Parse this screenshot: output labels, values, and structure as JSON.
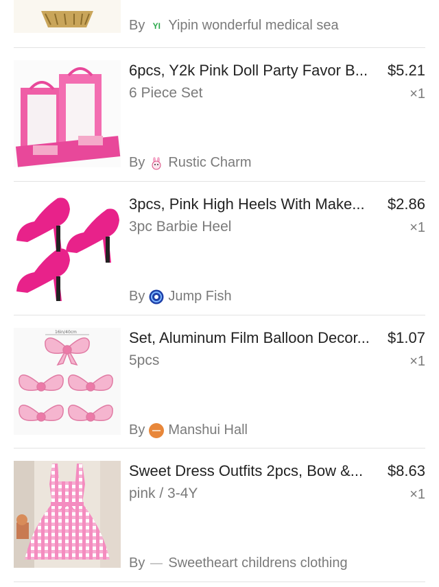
{
  "top_item": {
    "by_label": "By",
    "seller_logo_text": "YI",
    "seller": "Yipin wonderful medical sea"
  },
  "items": [
    {
      "title": "6pcs, Y2k Pink Doll Party Favor B...",
      "price": "$5.21",
      "variant": "6 Piece Set",
      "qty": "×1",
      "by_label": "By",
      "seller": "Rustic Charm",
      "seller_icon": "bunny-logo-icon",
      "thumb_icon": "pink-boxes-thumb"
    },
    {
      "title": "3pcs, Pink High Heels With Make...",
      "price": "$2.86",
      "variant": "3pc Barbie Heel",
      "qty": "×1",
      "by_label": "By",
      "seller": "Jump Fish",
      "seller_icon": "swirl-logo-icon",
      "thumb_icon": "pink-heels-thumb"
    },
    {
      "title": "Set, Aluminum Film Balloon Decor...",
      "price": "$1.07",
      "variant": "5pcs",
      "qty": "×1",
      "by_label": "By",
      "seller": "Manshui Hall",
      "seller_icon": "orange-circle-logo-icon",
      "thumb_icon": "bow-balloons-thumb",
      "thumb_text": "16in/40cm"
    },
    {
      "title": "Sweet Dress Outfits 2pcs, Bow &...",
      "price": "$8.63",
      "variant": "pink / 3-4Y",
      "qty": "×1",
      "by_label": "By",
      "seller": "Sweetheart childrens clothing",
      "seller_icon": "dash-logo-icon",
      "thumb_icon": "gingham-dress-thumb"
    }
  ],
  "colors": {
    "pink": "#e8489a",
    "light_pink": "#f4a9c9",
    "gray_text": "#7a7a7a",
    "divider": "#e2e2e2"
  }
}
